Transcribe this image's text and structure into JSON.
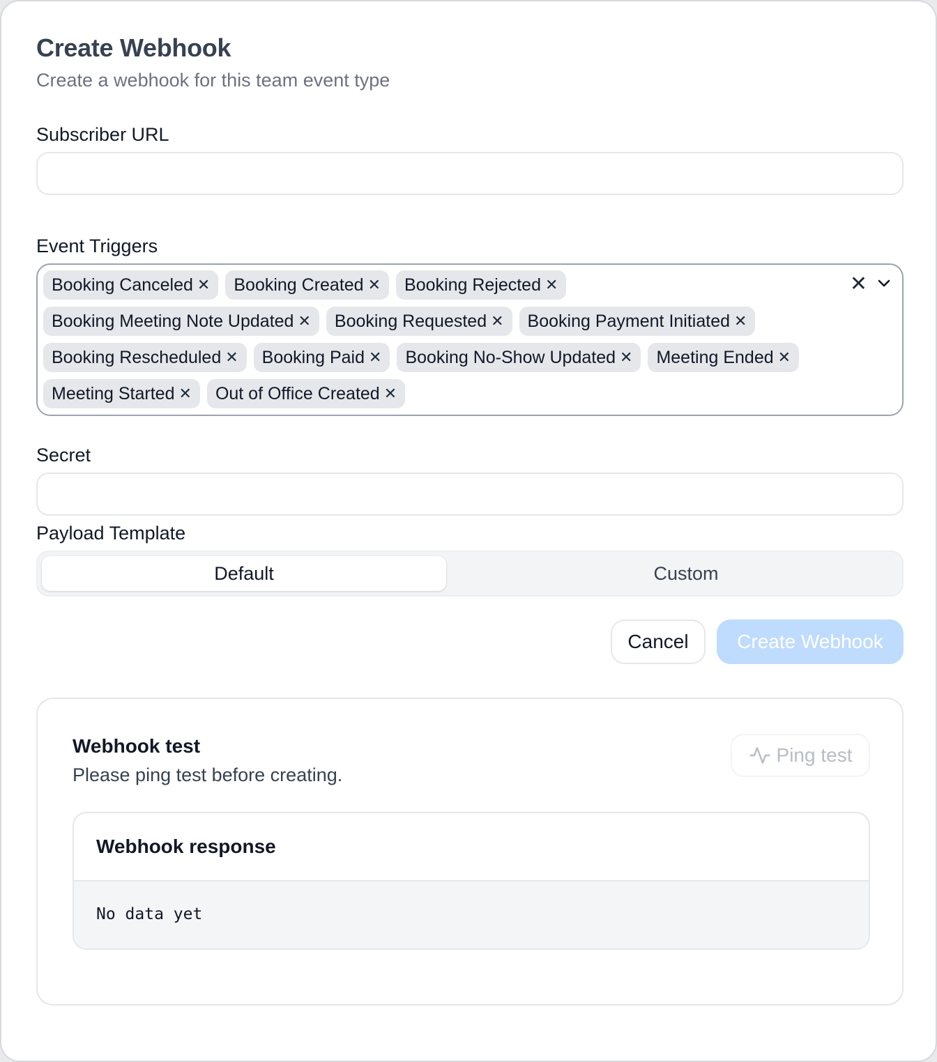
{
  "header": {
    "title": "Create Webhook",
    "subtitle": "Create a webhook for this team event type"
  },
  "subscriber_url": {
    "label": "Subscriber URL",
    "value": "",
    "placeholder": ""
  },
  "event_triggers": {
    "label": "Event Triggers",
    "selected": [
      "Booking Canceled",
      "Booking Created",
      "Booking Rejected",
      "Booking Meeting Note Updated",
      "Booking Requested",
      "Booking Payment Initiated",
      "Booking Rescheduled",
      "Booking Paid",
      "Booking No-Show Updated",
      "Meeting Ended",
      "Meeting Started",
      "Out of Office Created"
    ],
    "chip_remove_glyph": "✕",
    "clear_glyph": "✕"
  },
  "secret": {
    "label": "Secret",
    "value": "",
    "placeholder": ""
  },
  "payload_template": {
    "label": "Payload Template",
    "options": [
      "Default",
      "Custom"
    ],
    "selected": "Default"
  },
  "actions": {
    "cancel_label": "Cancel",
    "create_label": "Create Webhook"
  },
  "webhook_test": {
    "title": "Webhook test",
    "description": "Please ping test before creating.",
    "ping_label": "Ping test",
    "response_title": "Webhook response",
    "response_body": "No data yet"
  },
  "colors": {
    "primary_disabled": "#bfdbfe",
    "chip_bg": "#e5e7eb",
    "border": "#e5e7eb",
    "muted_text": "#6b7280"
  }
}
